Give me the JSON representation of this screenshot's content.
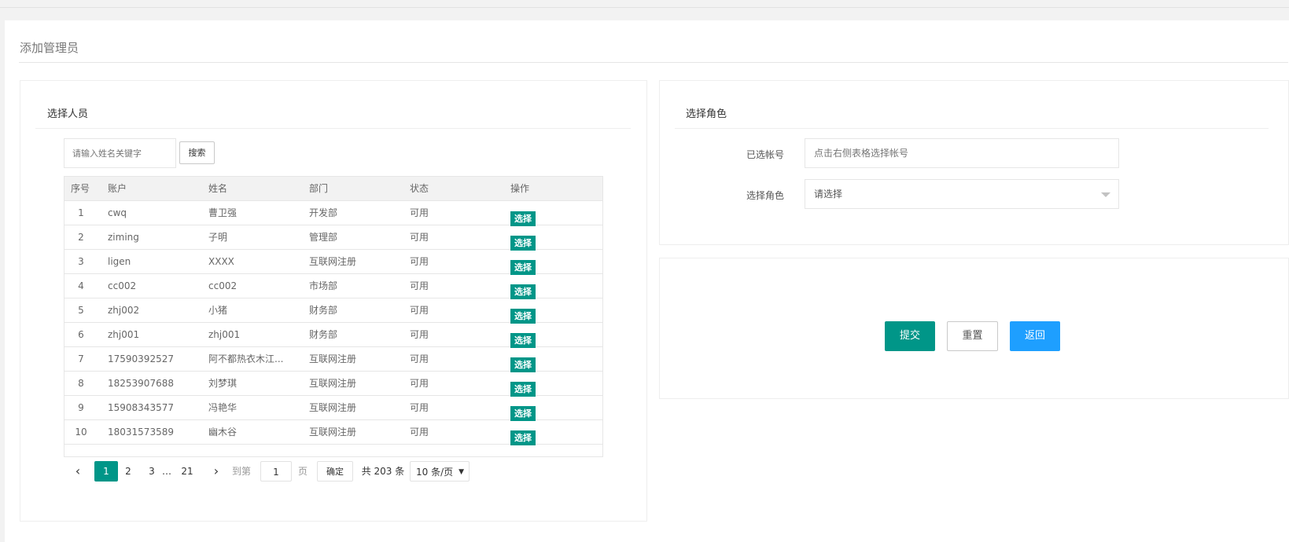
{
  "page": {
    "title": "添加管理员"
  },
  "left_panel": {
    "heading": "选择人员",
    "search": {
      "placeholder": "请输入姓名关键字",
      "button_label": "搜索"
    },
    "table": {
      "columns": [
        "序号",
        "账户",
        "姓名",
        "部门",
        "状态",
        "操作"
      ],
      "rows": [
        {
          "idx": "1",
          "account": "cwq",
          "name": "曹卫强",
          "dept": "开发部",
          "status": "可用",
          "action": "选择"
        },
        {
          "idx": "2",
          "account": "ziming",
          "name": "子明",
          "dept": "管理部",
          "status": "可用",
          "action": "选择"
        },
        {
          "idx": "3",
          "account": "ligen",
          "name": "XXXX",
          "dept": "互联网注册",
          "status": "可用",
          "action": "选择"
        },
        {
          "idx": "4",
          "account": "cc002",
          "name": "cc002",
          "dept": "市场部",
          "status": "可用",
          "action": "选择"
        },
        {
          "idx": "5",
          "account": "zhj002",
          "name": "小猪",
          "dept": "财务部",
          "status": "可用",
          "action": "选择"
        },
        {
          "idx": "6",
          "account": "zhj001",
          "name": "zhj001",
          "dept": "财务部",
          "status": "可用",
          "action": "选择"
        },
        {
          "idx": "7",
          "account": "17590392527",
          "name": "阿不都热衣木江...",
          "dept": "互联网注册",
          "status": "可用",
          "action": "选择"
        },
        {
          "idx": "8",
          "account": "18253907688",
          "name": "刘梦琪",
          "dept": "互联网注册",
          "status": "可用",
          "action": "选择"
        },
        {
          "idx": "9",
          "account": "15908343577",
          "name": "冯艳华",
          "dept": "互联网注册",
          "status": "可用",
          "action": "选择"
        },
        {
          "idx": "10",
          "account": "18031573589",
          "name": "幽木谷",
          "dept": "互联网注册",
          "status": "可用",
          "action": "选择"
        }
      ]
    },
    "pager": {
      "prev_icon": "chevron-left-icon",
      "pages": [
        "1",
        "2",
        "3"
      ],
      "ellipsis": "…",
      "last_page": "21",
      "next_icon": "chevron-right-icon",
      "goto_prefix": "到第",
      "goto_value": "1",
      "goto_suffix": "页",
      "confirm_label": "确定",
      "total_text": "共 203 条",
      "page_size": "10 条/页"
    }
  },
  "right_panel": {
    "heading": "选择角色",
    "account_label": "已选帐号",
    "account_placeholder": "点击右侧表格选择帐号",
    "role_label": "选择角色",
    "role_value": "请选择"
  },
  "actions": {
    "submit": "提交",
    "reset": "重置",
    "back": "返回"
  },
  "colors": {
    "primary": "#009688",
    "blue": "#1e9fff"
  }
}
